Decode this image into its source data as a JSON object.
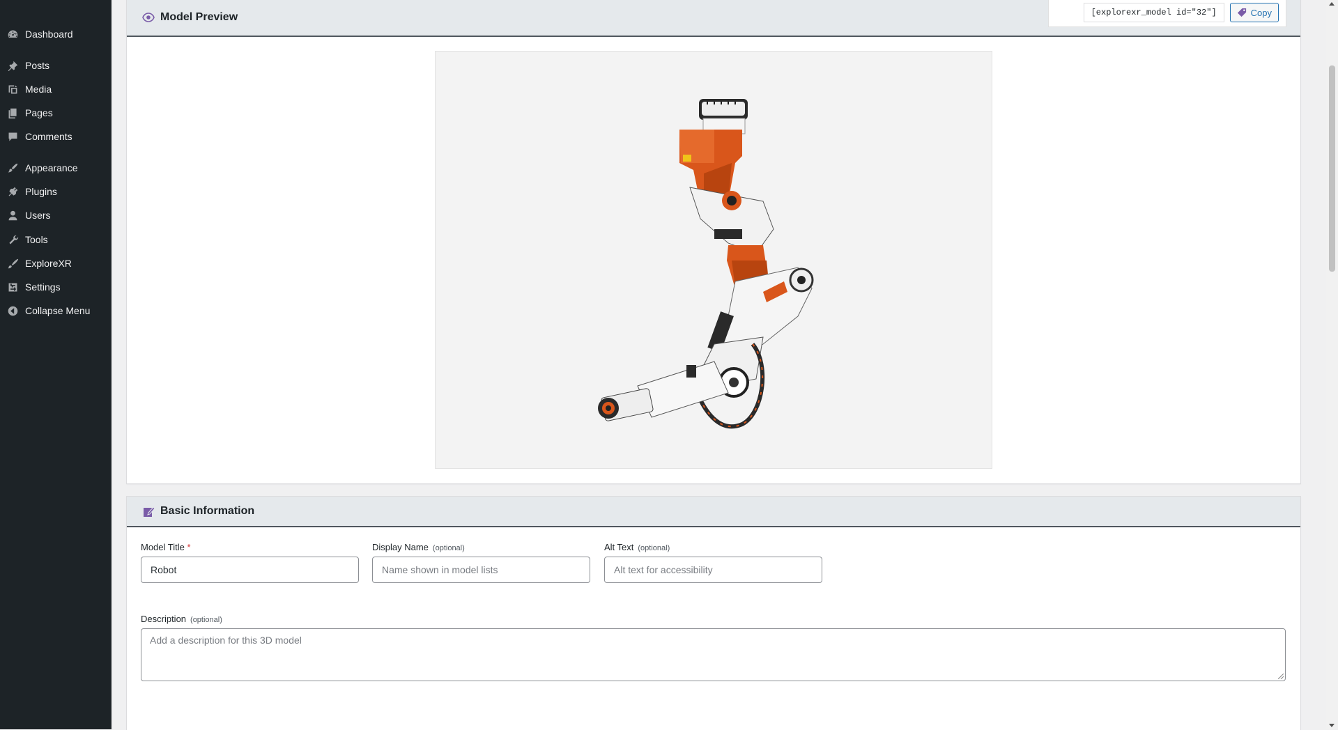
{
  "sidebar": {
    "items": [
      {
        "label": "Dashboard",
        "icon": "dashboard-icon"
      },
      {
        "label": "Posts",
        "icon": "pin-icon"
      },
      {
        "label": "Media",
        "icon": "media-icon"
      },
      {
        "label": "Pages",
        "icon": "pages-icon"
      },
      {
        "label": "Comments",
        "icon": "comment-icon"
      },
      {
        "label": "Appearance",
        "icon": "paintbrush-icon"
      },
      {
        "label": "Plugins",
        "icon": "plugin-icon"
      },
      {
        "label": "Users",
        "icon": "user-icon"
      },
      {
        "label": "Tools",
        "icon": "wrench-icon"
      },
      {
        "label": "ExploreXR",
        "icon": "brush-icon"
      },
      {
        "label": "Settings",
        "icon": "settings-icon"
      },
      {
        "label": "Collapse Menu",
        "icon": "collapse-icon"
      }
    ]
  },
  "preview": {
    "title": "Model Preview",
    "icon": "eye-icon",
    "shortcode": "[explorexr_model id=\"32\"]",
    "copy_label": "Copy",
    "copy_icon": "tag-icon",
    "model_alt": "robot arm 3D model"
  },
  "basic_info": {
    "title": "Basic Information",
    "icon": "edit-icon",
    "model_title": {
      "label": "Model Title",
      "required_mark": "*",
      "value": "Robot"
    },
    "display_name": {
      "label": "Display Name",
      "optional": "(optional)",
      "placeholder": "Name shown in model lists"
    },
    "alt_text": {
      "label": "Alt Text",
      "optional": "(optional)",
      "placeholder": "Alt text for accessibility"
    },
    "description": {
      "label": "Description",
      "optional": "(optional)",
      "placeholder": "Add a description for this 3D model"
    }
  },
  "colors": {
    "sidebar_bg": "#1d2327",
    "accent": "#2271b1",
    "icon_purple": "#7a5ca8",
    "robot_orange": "#d9561b"
  }
}
